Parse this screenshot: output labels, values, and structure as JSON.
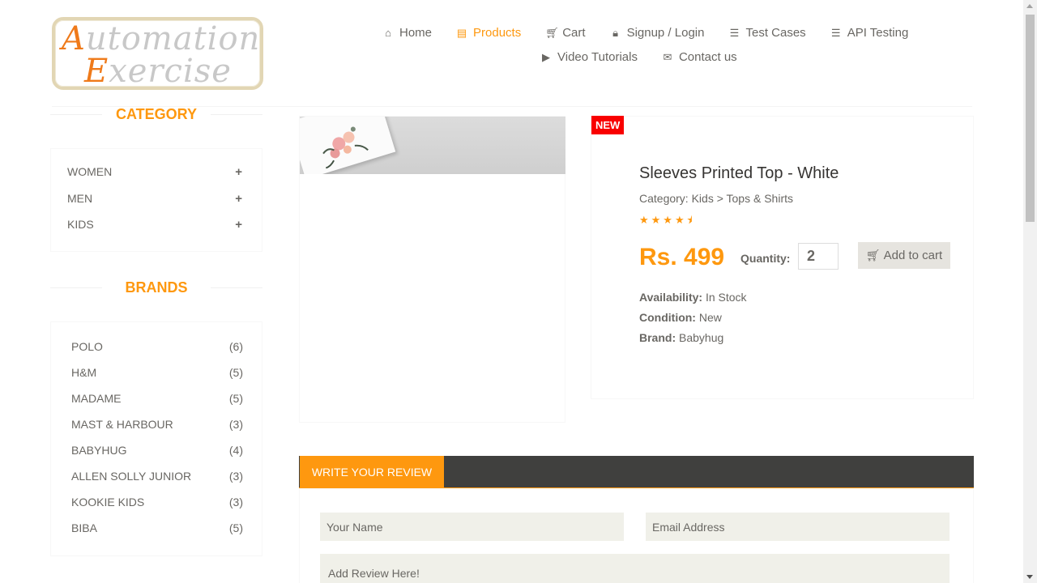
{
  "logo": {
    "line1_cap": "A",
    "line1_rest": "utomation",
    "line2_cap": "E",
    "line2_rest": "xercise"
  },
  "nav": {
    "items": [
      {
        "label": "Home",
        "icon": "home-icon",
        "glyph": "⌂"
      },
      {
        "label": "Products",
        "icon": "products-icon",
        "glyph": "▤",
        "active": true
      },
      {
        "label": "Cart",
        "icon": "cart-icon",
        "glyph": "🛒"
      },
      {
        "label": "Signup / Login",
        "icon": "lock-icon",
        "glyph": "🔒"
      },
      {
        "label": "Test Cases",
        "icon": "list-icon",
        "glyph": "☰"
      },
      {
        "label": "API Testing",
        "icon": "list-icon",
        "glyph": "☰"
      },
      {
        "label": "Video Tutorials",
        "icon": "youtube-icon",
        "glyph": "▶"
      },
      {
        "label": "Contact us",
        "icon": "envelope-icon",
        "glyph": "✉"
      }
    ]
  },
  "sidebar": {
    "category_title": "CATEGORY",
    "categories": [
      {
        "label": "WOMEN",
        "toggle": "+"
      },
      {
        "label": "MEN",
        "toggle": "+"
      },
      {
        "label": "KIDS",
        "toggle": "+"
      }
    ],
    "brands_title": "BRANDS",
    "brands": [
      {
        "label": "POLO",
        "count": "(6)"
      },
      {
        "label": "H&M",
        "count": "(5)"
      },
      {
        "label": "MADAME",
        "count": "(5)"
      },
      {
        "label": "MAST & HARBOUR",
        "count": "(3)"
      },
      {
        "label": "BABYHUG",
        "count": "(4)"
      },
      {
        "label": "ALLEN SOLLY JUNIOR",
        "count": "(3)"
      },
      {
        "label": "KOOKIE KIDS",
        "count": "(3)"
      },
      {
        "label": "BIBA",
        "count": "(5)"
      }
    ]
  },
  "product": {
    "badge": "NEW",
    "name": "Sleeves Printed Top - White",
    "category": "Category: Kids > Tops & Shirts",
    "rating": 4.5,
    "stars": "★★★★⯨",
    "price": "Rs. 499",
    "quantity_label": "Quantity:",
    "quantity": "2",
    "add_to_cart": "Add to cart",
    "availability_label": "Availability:",
    "availability": " In Stock",
    "condition_label": "Condition:",
    "condition": " New",
    "brand_label": "Brand:",
    "brand": " Babyhug"
  },
  "review": {
    "tab": "WRITE YOUR REVIEW",
    "name_placeholder": "Your Name",
    "email_placeholder": "Email Address",
    "review_placeholder": "Add Review Here!"
  },
  "colors": {
    "accent": "#fe980f",
    "badge": "#f90000",
    "dark_bar": "#40403e",
    "input_bg": "#f0f0e9"
  }
}
